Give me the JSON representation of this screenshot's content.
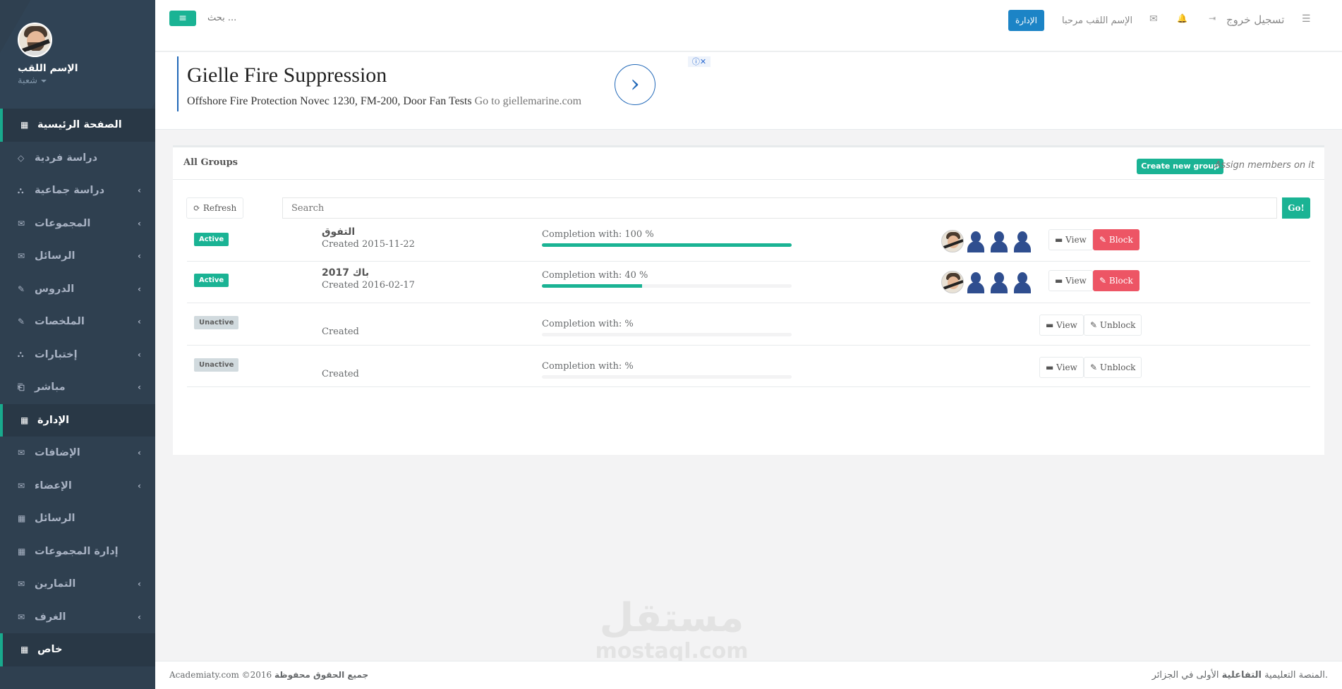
{
  "sidebar": {
    "profile_name": "الإسم اللقب",
    "profile_role": "شعبة",
    "items": [
      {
        "label": "الصفحة الرئيسية",
        "icon": "▦",
        "active": true,
        "chevron": false
      },
      {
        "label": "دراسة فردية",
        "icon": "◇",
        "active": false,
        "chevron": false
      },
      {
        "label": "دراسة جماعية",
        "icon": "⛬",
        "active": false,
        "chevron": true
      },
      {
        "label": "المجموعات",
        "icon": "✉",
        "active": false,
        "chevron": true
      },
      {
        "label": "الرسائل",
        "icon": "✉",
        "active": false,
        "chevron": true
      },
      {
        "label": "الدروس",
        "icon": "✎",
        "active": false,
        "chevron": true
      },
      {
        "label": "الملخصات",
        "icon": "✎",
        "active": false,
        "chevron": true
      },
      {
        "label": "إختبارات",
        "icon": "⛬",
        "active": false,
        "chevron": true
      },
      {
        "label": "مباشر",
        "icon": "⎗",
        "active": false,
        "chevron": true
      },
      {
        "label": "الإدارة",
        "icon": "▦",
        "active": true,
        "chevron": false
      },
      {
        "label": "الإضافات",
        "icon": "✉",
        "active": false,
        "chevron": true
      },
      {
        "label": "الإعضاء",
        "icon": "✉",
        "active": false,
        "chevron": true
      },
      {
        "label": "الرسائل",
        "icon": "▦",
        "active": false,
        "chevron": false
      },
      {
        "label": "إدارة المجموعات",
        "icon": "▦",
        "active": false,
        "chevron": false
      },
      {
        "label": "التمارين",
        "icon": "✉",
        "active": false,
        "chevron": true
      },
      {
        "label": "الغرف",
        "icon": "✉",
        "active": false,
        "chevron": true
      },
      {
        "label": "خاص",
        "icon": "▦",
        "active": true,
        "chevron": false
      }
    ]
  },
  "topbar": {
    "menu_icon": "≡",
    "search_placeholder": "... بحث",
    "admin_label": "الإدارة",
    "welcome": "الإسم اللقب مرحبا",
    "logout": "تسجيل خروج",
    "mail_icon": "✉",
    "bell_icon": "🔔",
    "logout_icon": "⇥",
    "list_icon": "☰"
  },
  "ad": {
    "title": "Gielle Fire Suppression",
    "text": "Offshore Fire Protection Novec 1230, FM-200, Door Fan Tests",
    "link": "Go to giellemarine.com",
    "arrow": "›",
    "close": "ⓘ✕"
  },
  "panel": {
    "title": "All Groups",
    "create_label": "Create new group",
    "assign_label": "Assign members on it",
    "refresh_label": "⟳ Refresh",
    "search_placeholder": "Search",
    "go_label": "Go!",
    "view_label": "▬ View",
    "block_label": "✎ Block",
    "unblock_label": "✎ Unblock",
    "groups": [
      {
        "status": "Active",
        "name": "التفوق",
        "created": "Created 2015-11-22",
        "completion": "Completion with: 100 %",
        "progress": 100,
        "members": true,
        "action": "block"
      },
      {
        "status": "Active",
        "name": "باك 2017",
        "created": "Created 2016-02-17",
        "completion": "Completion with: 40 %",
        "progress": 40,
        "members": true,
        "action": "block"
      },
      {
        "status": "Unactive",
        "name": "",
        "created": "Created",
        "completion": "Completion with: %",
        "progress": 0,
        "members": false,
        "action": "unblock"
      },
      {
        "status": "Unactive",
        "name": "",
        "created": "Created",
        "completion": "Completion with: %",
        "progress": 0,
        "members": false,
        "action": "unblock"
      }
    ]
  },
  "footer": {
    "left_site": "Academiaty.com ©2016",
    "left_rights": "جميع الحقوق محفوظة",
    "right_prefix": ".المنصة التعليمية",
    "right_bold": "التفاعلية",
    "right_suffix": "الأولى في الجزائر"
  },
  "watermark": {
    "arabic": "مستقل",
    "latin": "mostaql.com"
  },
  "colors": {
    "sidebar": "#2f4050",
    "accent": "#1ab394",
    "danger": "#ed5565",
    "primary": "#1c84c6"
  }
}
